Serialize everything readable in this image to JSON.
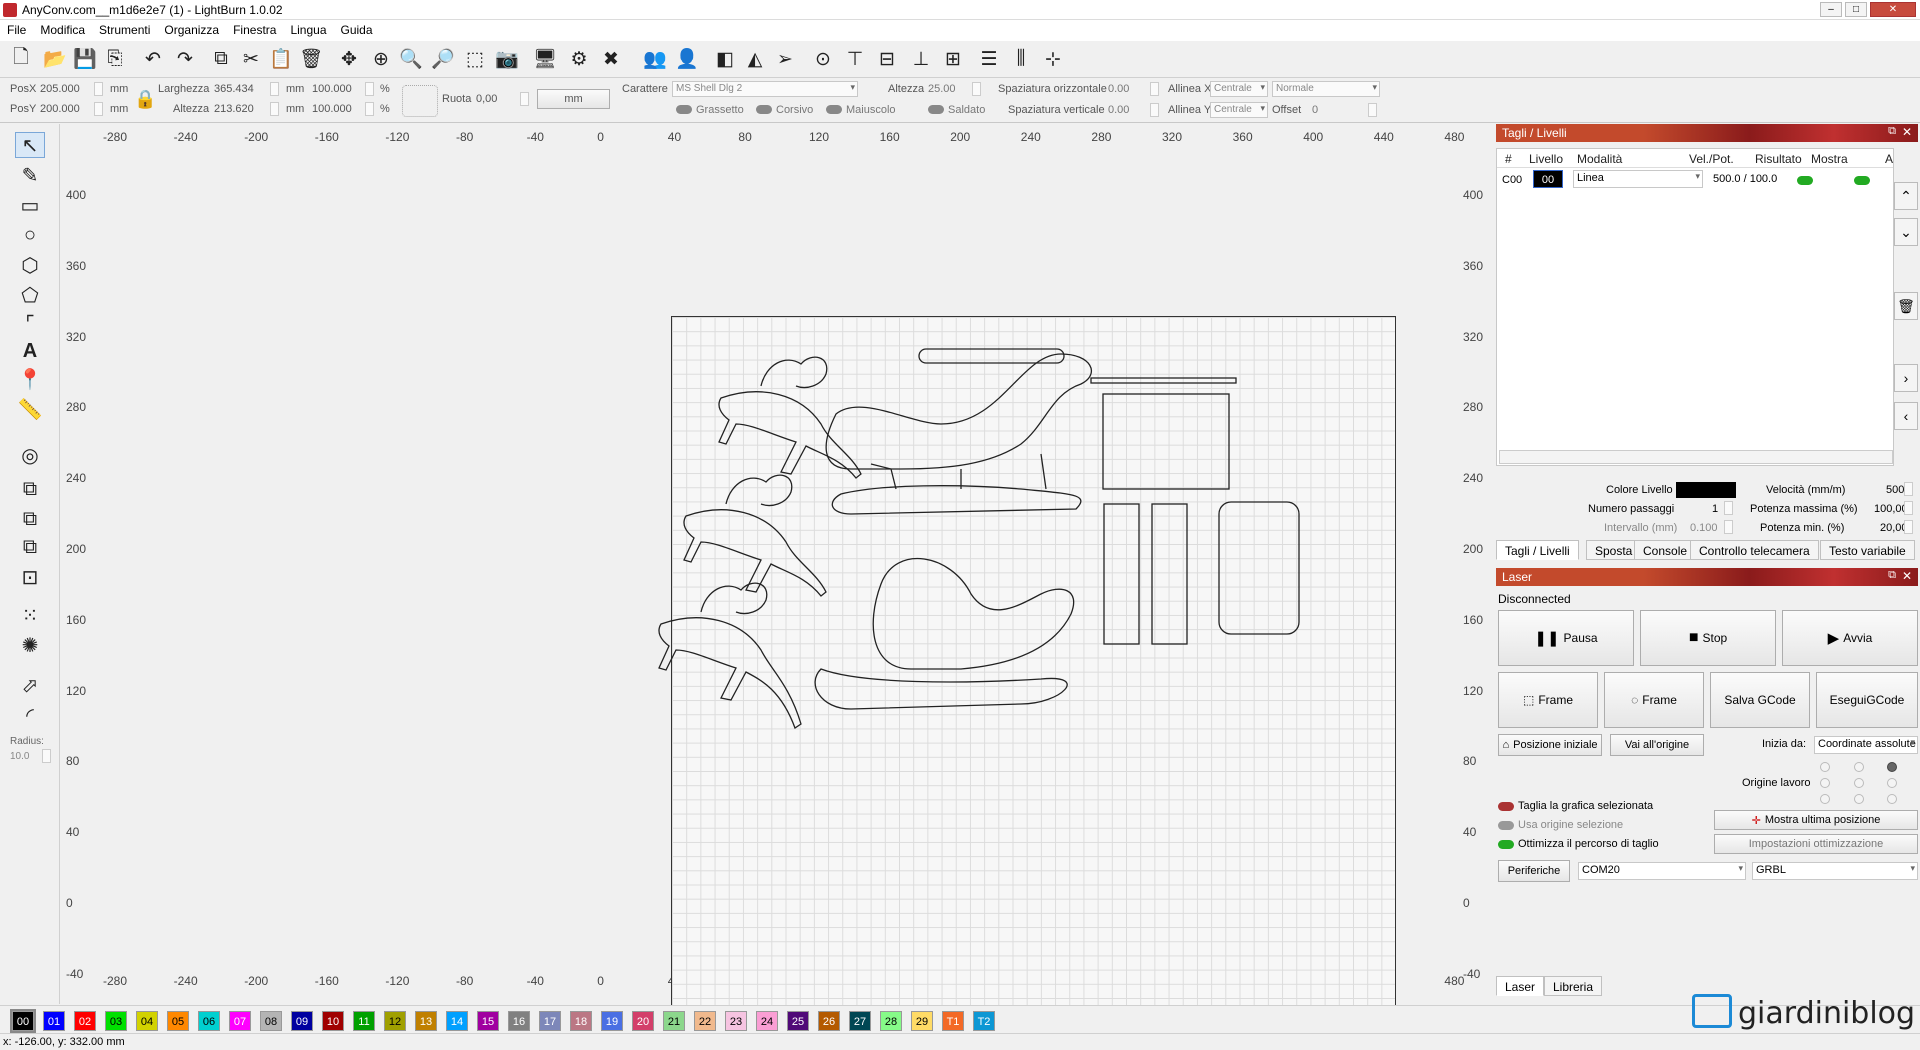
{
  "window": {
    "title": "AnyConv.com__m1d6e2e7 (1) - LightBurn 1.0.02"
  },
  "menu": [
    "File",
    "Modifica",
    "Strumenti",
    "Organizza",
    "Finestra",
    "Lingua",
    "Guida"
  ],
  "props": {
    "posx_label": "PosX",
    "posx": "205.000",
    "posy_label": "PosY",
    "posy": "200.000",
    "unit": "mm",
    "width_label": "Larghezza",
    "width": "365.434",
    "height_label": "Altezza",
    "height": "213.620",
    "scale_x": "100.000",
    "scale_y": "100.000",
    "pct": "%",
    "rotate_label": "Ruota",
    "rotate": "0,00",
    "unit_button": "mm",
    "font_label": "Carattere",
    "font": "MS Shell Dlg 2",
    "text_height_label": "Altezza",
    "text_height": "25.00",
    "hspace_label": "Spaziatura orizzontale",
    "hspace": "0.00",
    "vspace_label": "Spaziatura verticale",
    "vspace": "0.00",
    "alignx_label": "Allinea X",
    "alignx": "Centrale",
    "aligny_label": "Allinea Y",
    "aligny": "Centrale",
    "style": "Normale",
    "offset_label": "Offset",
    "offset": "0",
    "bold": "Grassetto",
    "italic": "Corsivo",
    "upper": "Maiuscolo",
    "welded": "Saldato"
  },
  "left_tools": {
    "radius_label": "Radius:",
    "radius": "10.0"
  },
  "ruler": {
    "x_ticks": [
      "-280",
      "-240",
      "-200",
      "-160",
      "-120",
      "-80",
      "-40",
      "0",
      "40",
      "80",
      "120",
      "160",
      "200",
      "240",
      "280",
      "320",
      "360",
      "400",
      "440",
      "480"
    ],
    "y_ticks": [
      "400",
      "360",
      "320",
      "280",
      "240",
      "200",
      "160",
      "120",
      "80",
      "40",
      "0",
      "-40"
    ]
  },
  "cuts_panel": {
    "title": "Tagli / Livelli",
    "headers": [
      "#",
      "Livello",
      "Modalità",
      "Vel./Pot.",
      "Risultato",
      "Mostra",
      "A"
    ],
    "rows": [
      {
        "id": "C00",
        "layer": "00",
        "mode": "Linea",
        "speed_power": "500.0 / 100.0"
      }
    ],
    "color_label": "Colore Livello",
    "speed_label": "Velocità (mm/m)",
    "speed": "500",
    "passes_label": "Numero passaggi",
    "passes": "1",
    "max_power_label": "Potenza massima (%)",
    "max_power": "100,00",
    "interval_label": "Intervallo (mm)",
    "interval": "0.100",
    "min_power_label": "Potenza min. (%)",
    "min_power": "20,00",
    "tabs": [
      "Tagli / Livelli",
      "Sposta",
      "Console",
      "Controllo telecamera",
      "Testo variabile"
    ]
  },
  "laser_panel": {
    "title": "Laser",
    "status": "Disconnected",
    "pause": "Pausa",
    "stop": "Stop",
    "start": "Avvia",
    "frame1": "Frame",
    "frame2": "Frame",
    "save_gcode": "Salva GCode",
    "run_gcode": "EseguiGCode",
    "home": "Posizione iniziale",
    "goto_origin": "Vai all'origine",
    "start_from_label": "Inizia da:",
    "start_from": "Coordinate assolute",
    "job_origin_label": "Origine lavoro",
    "cut_selected": "Taglia la grafica selezionata",
    "use_selection_origin": "Usa origine selezione",
    "optimize": "Ottimizza il percorso di taglio",
    "show_last_pos": "Mostra ultima posizione",
    "opt_settings": "Impostazioni ottimizzazione",
    "devices": "Periferiche",
    "port": "COM20",
    "controller": "GRBL",
    "tabs": [
      "Laser",
      "Libreria"
    ]
  },
  "palette": [
    {
      "label": "00",
      "color": "#000000"
    },
    {
      "label": "01",
      "color": "#0000ff"
    },
    {
      "label": "02",
      "color": "#ff0000"
    },
    {
      "label": "03",
      "color": "#00e000"
    },
    {
      "label": "04",
      "color": "#d2d200"
    },
    {
      "label": "05",
      "color": "#ff8800"
    },
    {
      "label": "06",
      "color": "#00d0d0"
    },
    {
      "label": "07",
      "color": "#ff00ff"
    },
    {
      "label": "08",
      "color": "#b4b4b4"
    },
    {
      "label": "09",
      "color": "#0000a0"
    },
    {
      "label": "10",
      "color": "#a00000"
    },
    {
      "label": "11",
      "color": "#00a000"
    },
    {
      "label": "12",
      "color": "#a0a000"
    },
    {
      "label": "13",
      "color": "#c08000"
    },
    {
      "label": "14",
      "color": "#00a0ff"
    },
    {
      "label": "15",
      "color": "#a000a0"
    },
    {
      "label": "16",
      "color": "#808080"
    },
    {
      "label": "17",
      "color": "#7d87b9"
    },
    {
      "label": "18",
      "color": "#bb7784"
    },
    {
      "label": "19",
      "color": "#4a6fe3"
    },
    {
      "label": "20",
      "color": "#d33f6a"
    },
    {
      "label": "21",
      "color": "#8cd78c"
    },
    {
      "label": "22",
      "color": "#f0b98d"
    },
    {
      "label": "23",
      "color": "#f6c4e1"
    },
    {
      "label": "24",
      "color": "#fa9ed4"
    },
    {
      "label": "25",
      "color": "#500a78"
    },
    {
      "label": "26",
      "color": "#b45a00"
    },
    {
      "label": "27",
      "color": "#004754"
    },
    {
      "label": "28",
      "color": "#86fa88"
    },
    {
      "label": "29",
      "color": "#ffdb66"
    },
    {
      "label": "T1",
      "color": "#f36926"
    },
    {
      "label": "T2",
      "color": "#0c97d4"
    }
  ],
  "status": {
    "coords": "x: -126.00, y: 332.00 mm"
  },
  "brand": {
    "text": "giardiniblog"
  }
}
